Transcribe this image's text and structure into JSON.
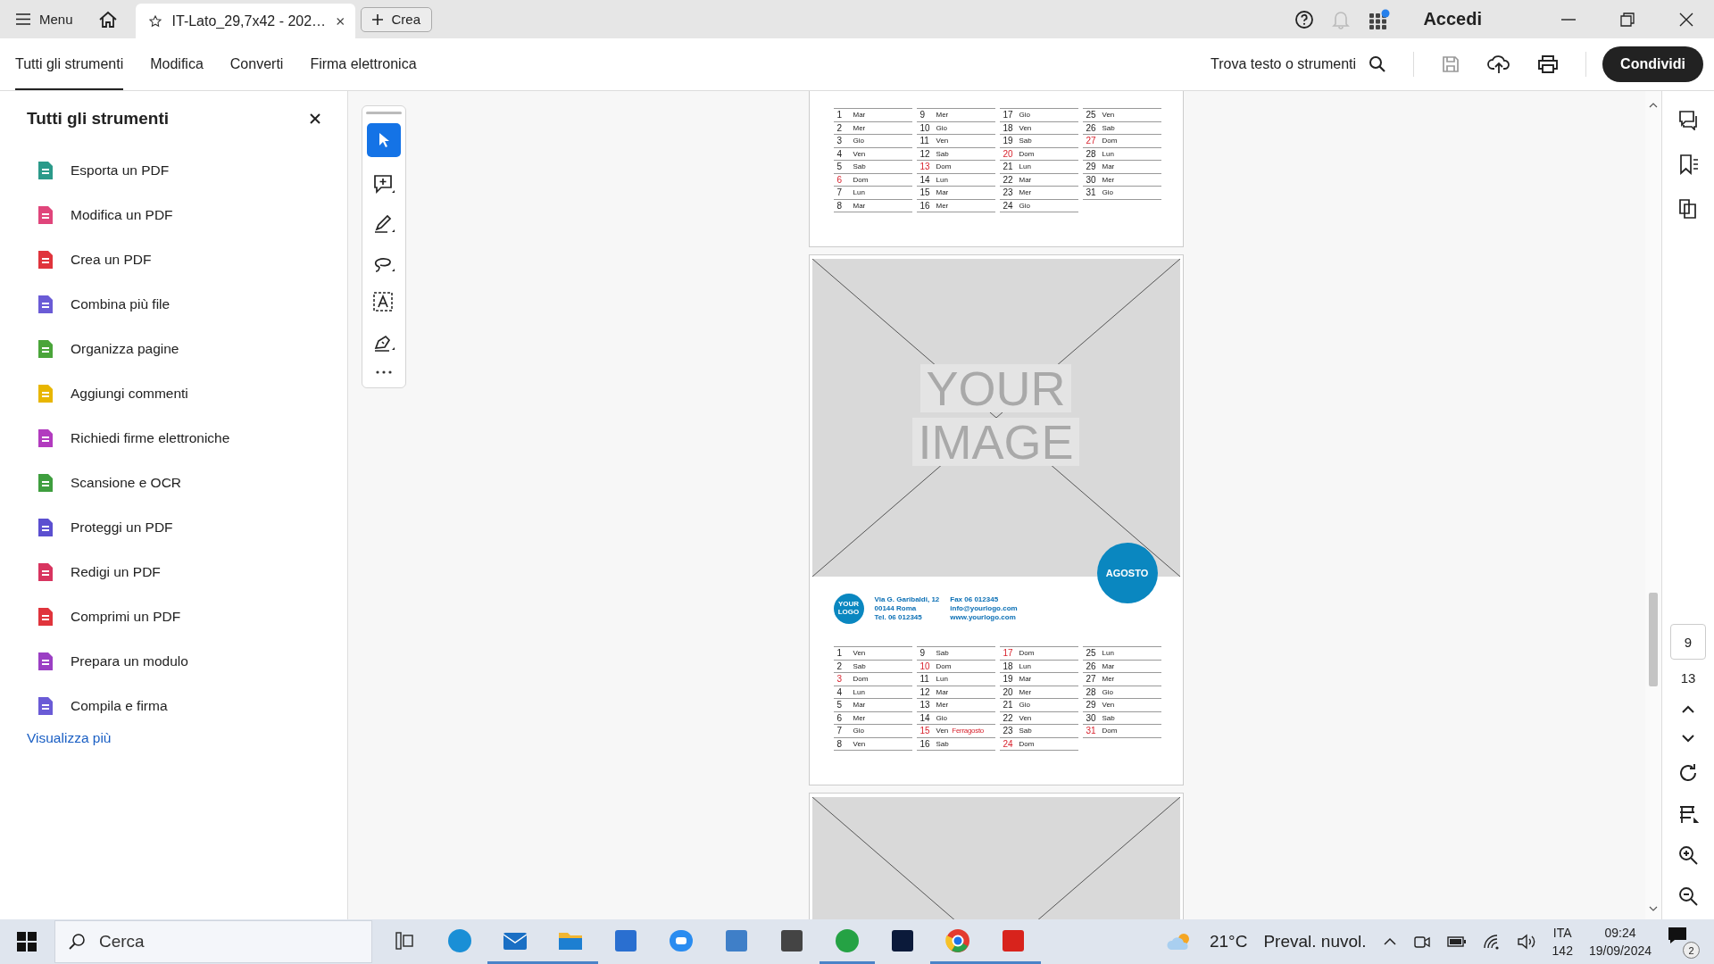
{
  "title_bar": {
    "menu": "Menu",
    "tab": {
      "title": "IT-Lato_29,7x42 - 202…"
    },
    "new_button": "Crea",
    "sign_in": "Accedi"
  },
  "toolbar": {
    "tabs": [
      {
        "label": "Tutti gli strumenti",
        "selected": true
      },
      {
        "label": "Modifica",
        "selected": false
      },
      {
        "label": "Converti",
        "selected": false
      },
      {
        "label": "Firma elettronica",
        "selected": false
      }
    ],
    "search": "Trova testo o strumenti",
    "share": "Condividi"
  },
  "tools_panel": {
    "title": "Tutti gli strumenti",
    "items": [
      {
        "label": "Esporta un PDF",
        "color": "#2b9a8a"
      },
      {
        "label": "Modifica un PDF",
        "color": "#e0457b"
      },
      {
        "label": "Crea un PDF",
        "color": "#e0343c"
      },
      {
        "label": "Combina più file",
        "color": "#6a5bd6"
      },
      {
        "label": "Organizza pagine",
        "color": "#4aa53a"
      },
      {
        "label": "Aggiungi commenti",
        "color": "#e8b600"
      },
      {
        "label": "Richiedi firme elettroniche",
        "color": "#b23bbf"
      },
      {
        "label": "Scansione e OCR",
        "color": "#3e9e3e"
      },
      {
        "label": "Proteggi un PDF",
        "color": "#5b4fd0"
      },
      {
        "label": "Redigi un PDF",
        "color": "#d8345f"
      },
      {
        "label": "Comprimi un PDF",
        "color": "#e0343c"
      },
      {
        "label": "Prepara un modulo",
        "color": "#9b3fc4"
      },
      {
        "label": "Compila e firma",
        "color": "#6a5bd6"
      }
    ],
    "more_link": "Visualizza più"
  },
  "document": {
    "pages": [
      {
        "kind": "calendar",
        "days": [
          {
            "day": "1",
            "weekday": "Mar",
            "holiday": false
          },
          {
            "day": "2",
            "weekday": "Mer",
            "holiday": false
          },
          {
            "day": "3",
            "weekday": "Gio",
            "holiday": false
          },
          {
            "day": "4",
            "weekday": "Ven",
            "holiday": false
          },
          {
            "day": "5",
            "weekday": "Sab",
            "holiday": false
          },
          {
            "day": "6",
            "weekday": "Dom",
            "holiday": true
          },
          {
            "day": "7",
            "weekday": "Lun",
            "holiday": false
          },
          {
            "day": "8",
            "weekday": "Mar",
            "holiday": false
          },
          {
            "day": "9",
            "weekday": "Mer",
            "holiday": false
          },
          {
            "day": "10",
            "weekday": "Gio",
            "holiday": false
          },
          {
            "day": "11",
            "weekday": "Ven",
            "holiday": false
          },
          {
            "day": "12",
            "weekday": "Sab",
            "holiday": false
          },
          {
            "day": "13",
            "weekday": "Dom",
            "holiday": true
          },
          {
            "day": "14",
            "weekday": "Lun",
            "holiday": false
          },
          {
            "day": "15",
            "weekday": "Mar",
            "holiday": false
          },
          {
            "day": "16",
            "weekday": "Mer",
            "holiday": false
          },
          {
            "day": "17",
            "weekday": "Gio",
            "holiday": false
          },
          {
            "day": "18",
            "weekday": "Ven",
            "holiday": false
          },
          {
            "day": "19",
            "weekday": "Sab",
            "holiday": false
          },
          {
            "day": "20",
            "weekday": "Dom",
            "holiday": true
          },
          {
            "day": "21",
            "weekday": "Lun",
            "holiday": false
          },
          {
            "day": "22",
            "weekday": "Mar",
            "holiday": false
          },
          {
            "day": "23",
            "weekday": "Mer",
            "holiday": false
          },
          {
            "day": "24",
            "weekday": "Gio",
            "holiday": false
          },
          {
            "day": "25",
            "weekday": "Ven",
            "holiday": false
          },
          {
            "day": "26",
            "weekday": "Sab",
            "holiday": false
          },
          {
            "day": "27",
            "weekday": "Dom",
            "holiday": true
          },
          {
            "day": "28",
            "weekday": "Lun",
            "holiday": false
          },
          {
            "day": "29",
            "weekday": "Mar",
            "holiday": false
          },
          {
            "day": "30",
            "weekday": "Mer",
            "holiday": false
          },
          {
            "day": "31",
            "weekday": "Gio",
            "holiday": false
          }
        ]
      },
      {
        "kind": "month",
        "image_text": [
          "YOUR",
          "IMAGE"
        ],
        "month": "AGOSTO",
        "logo": [
          "YOUR",
          "LOGO"
        ],
        "contact": [
          [
            "Via G. Garibaldi, 12",
            "00144 Roma",
            "Tel. 06 012345"
          ],
          [
            "Fax 06 012345",
            "info@yourlogo.com",
            "www.yourlogo.com"
          ]
        ],
        "days": [
          {
            "day": "1",
            "weekday": "Ven",
            "holiday": false
          },
          {
            "day": "2",
            "weekday": "Sab",
            "holiday": false
          },
          {
            "day": "3",
            "weekday": "Dom",
            "holiday": true
          },
          {
            "day": "4",
            "weekday": "Lun",
            "holiday": false
          },
          {
            "day": "5",
            "weekday": "Mar",
            "holiday": false
          },
          {
            "day": "6",
            "weekday": "Mer",
            "holiday": false
          },
          {
            "day": "7",
            "weekday": "Gio",
            "holiday": false
          },
          {
            "day": "8",
            "weekday": "Ven",
            "holiday": false
          },
          {
            "day": "9",
            "weekday": "Sab",
            "holiday": false
          },
          {
            "day": "10",
            "weekday": "Dom",
            "holiday": true
          },
          {
            "day": "11",
            "weekday": "Lun",
            "holiday": false
          },
          {
            "day": "12",
            "weekday": "Mar",
            "holiday": false
          },
          {
            "day": "13",
            "weekday": "Mer",
            "holiday": false
          },
          {
            "day": "14",
            "weekday": "Gio",
            "holiday": false
          },
          {
            "day": "15",
            "weekday": "Ven",
            "holiday": true,
            "note": "Ferragosto"
          },
          {
            "day": "16",
            "weekday": "Sab",
            "holiday": false
          },
          {
            "day": "17",
            "weekday": "Dom",
            "holiday": true
          },
          {
            "day": "18",
            "weekday": "Lun",
            "holiday": false
          },
          {
            "day": "19",
            "weekday": "Mar",
            "holiday": false
          },
          {
            "day": "20",
            "weekday": "Mer",
            "holiday": false
          },
          {
            "day": "21",
            "weekday": "Gio",
            "holiday": false
          },
          {
            "day": "22",
            "weekday": "Ven",
            "holiday": false
          },
          {
            "day": "23",
            "weekday": "Sab",
            "holiday": false
          },
          {
            "day": "24",
            "weekday": "Dom",
            "holiday": true
          },
          {
            "day": "25",
            "weekday": "Lun",
            "holiday": false
          },
          {
            "day": "26",
            "weekday": "Mar",
            "holiday": false
          },
          {
            "day": "27",
            "weekday": "Mer",
            "holiday": false
          },
          {
            "day": "28",
            "weekday": "Gio",
            "holiday": false
          },
          {
            "day": "29",
            "weekday": "Ven",
            "holiday": false
          },
          {
            "day": "30",
            "weekday": "Sab",
            "holiday": false
          },
          {
            "day": "31",
            "weekday": "Dom",
            "holiday": true
          }
        ]
      },
      {
        "kind": "image"
      }
    ]
  },
  "page_nav": {
    "current": "9",
    "total": "13"
  },
  "taskbar": {
    "search": "Cerca",
    "temperature": "21°C",
    "weather": "Preval. nuvol.",
    "language": "ITA",
    "keyboard": "142",
    "time": "09:24",
    "date": "19/09/2024",
    "notifications": "2"
  }
}
